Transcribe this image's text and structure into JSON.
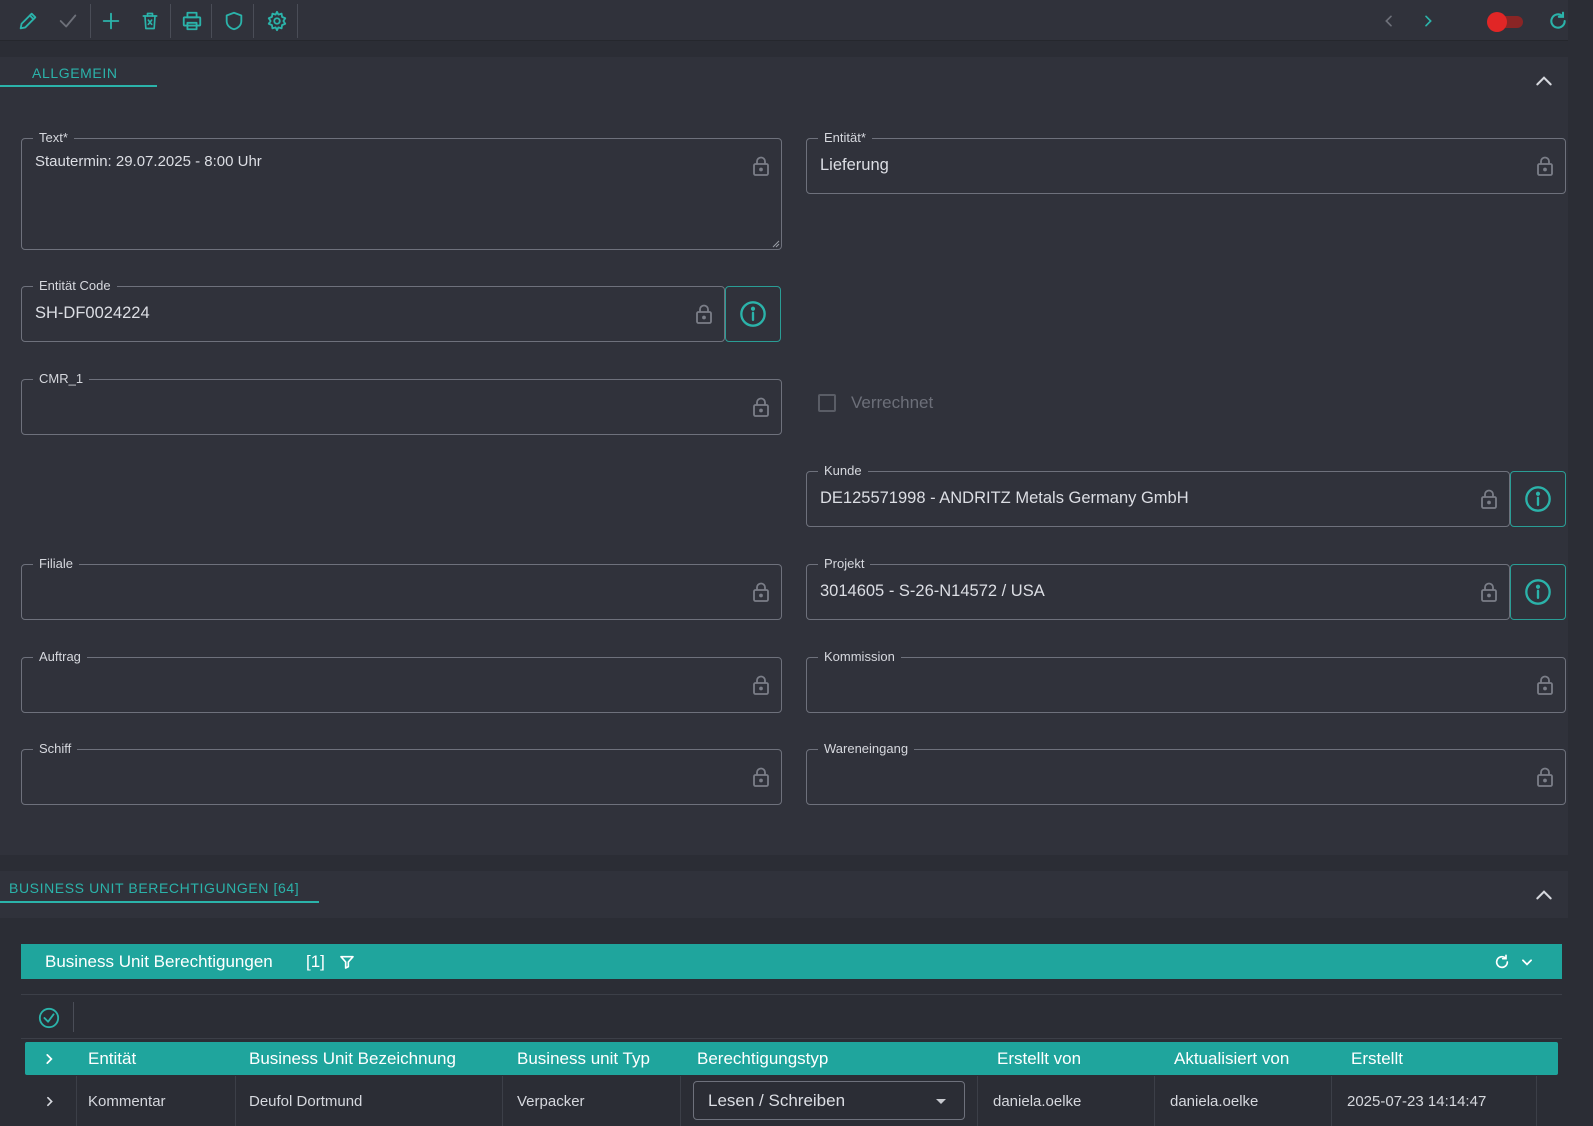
{
  "toolbar": {
    "icons": [
      "pencil-icon",
      "check-icon",
      "plus-icon",
      "delete-icon",
      "printer-icon",
      "shield-icon",
      "gear-icon",
      "chevron-left-icon",
      "chevron-right-icon",
      "toggle",
      "refresh-icon"
    ],
    "toggle_state": "off",
    "accent_color": "#2bb3aa"
  },
  "section_general": {
    "tab_label": "ALLGEMEIN"
  },
  "form": {
    "text": {
      "label": "Text*",
      "value": "Stautermin: 29.07.2025 - 8:00 Uhr"
    },
    "entitaet": {
      "label": "Entität*",
      "value": "Lieferung"
    },
    "entitaet_code": {
      "label": "Entität Code",
      "value": "SH-DF0024224"
    },
    "cmr1": {
      "label": "CMR_1",
      "value": ""
    },
    "verrechnet": {
      "label": "Verrechnet",
      "checked": false
    },
    "kunde": {
      "label": "Kunde",
      "value": "DE125571998 - ANDRITZ Metals Germany GmbH"
    },
    "filiale": {
      "label": "Filiale",
      "value": ""
    },
    "projekt": {
      "label": "Projekt",
      "value": "3014605 - S-26-N14572 / USA"
    },
    "auftrag": {
      "label": "Auftrag",
      "value": ""
    },
    "kommission": {
      "label": "Kommission",
      "value": ""
    },
    "schiff": {
      "label": "Schiff",
      "value": ""
    },
    "wareneingang": {
      "label": "Wareneingang",
      "value": ""
    }
  },
  "section_permissions": {
    "tab_label": "BUSINESS UNIT BERECHTIGUNGEN [64]",
    "grid_title": "Business Unit Berechtigungen",
    "grid_count": "[1]",
    "columns": [
      "Entität",
      "Business Unit Bezeichnung",
      "Business unit Typ",
      "Berechtigungstyp",
      "Erstellt von",
      "Aktualisiert von",
      "Erstellt"
    ],
    "rows": [
      {
        "entitaet": "Kommentar",
        "bezeichnung": "Deufol Dortmund",
        "typ": "Verpacker",
        "berechtigungstyp": "Lesen / Schreiben",
        "erstellt_von": "daniela.oelke",
        "aktualisiert_von": "daniela.oelke",
        "erstellt": "2025-07-23 14:14:47"
      }
    ]
  }
}
